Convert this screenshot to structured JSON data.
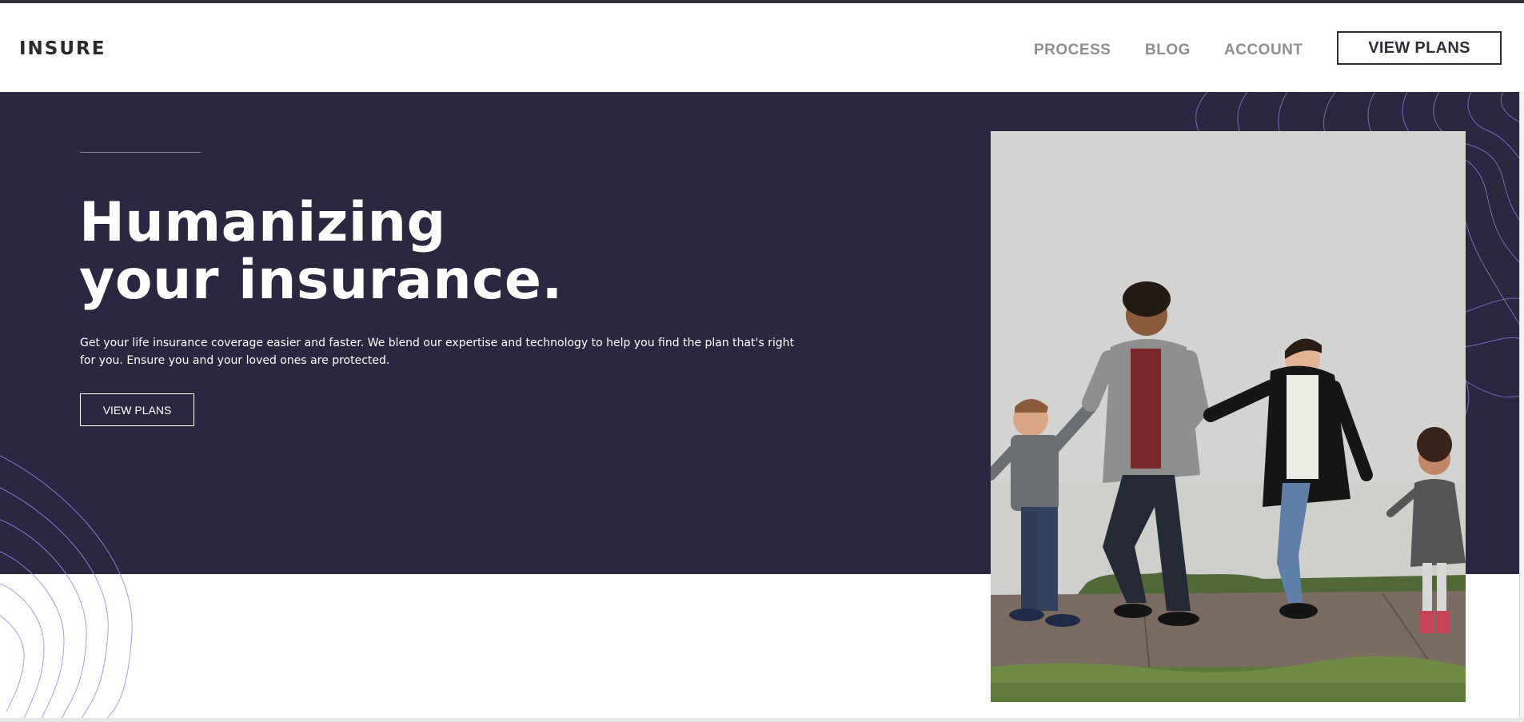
{
  "brand": {
    "logo": "INSURE"
  },
  "nav": {
    "items": [
      {
        "label": "PROCESS"
      },
      {
        "label": "BLOG"
      },
      {
        "label": "ACCOUNT"
      }
    ],
    "cta_label": "VIEW PLANS"
  },
  "hero": {
    "title_line1": "Humanizing",
    "title_line2": "your insurance.",
    "description": "Get your life insurance coverage easier and faster. We blend our expertise and technology to help you find the plan that's right for you. Ensure you and your loved ones are protected.",
    "cta_label": "VIEW PLANS"
  },
  "colors": {
    "hero_bg": "#2c2640",
    "accent_lines": "#8d8ff0",
    "text_dark": "#2c2830",
    "nav_text": "#8e8c94"
  },
  "images": {
    "hero_photo": "family-walking-photo"
  }
}
